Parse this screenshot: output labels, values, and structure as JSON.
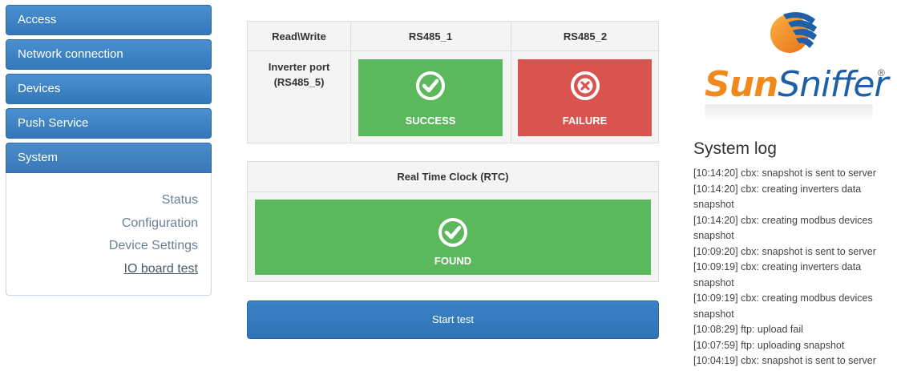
{
  "sidebar": {
    "items": [
      {
        "label": "Access"
      },
      {
        "label": "Network connection"
      },
      {
        "label": "Devices"
      },
      {
        "label": "Push Service"
      },
      {
        "label": "System"
      }
    ],
    "submenu": [
      {
        "label": "Status"
      },
      {
        "label": "Configuration"
      },
      {
        "label": "Device Settings"
      },
      {
        "label": "IO board test"
      }
    ]
  },
  "port_test": {
    "header_rw": "Read\\Write",
    "col1": "RS485_1",
    "col2": "RS485_2",
    "row_label": "Inverter port (RS485_5)",
    "result1": {
      "label": "SUCCESS",
      "icon": "check-circle-icon",
      "color": "#5cb85c"
    },
    "result2": {
      "label": "FAILURE",
      "icon": "x-circle-icon",
      "color": "#d9534f"
    }
  },
  "rtc": {
    "title": "Real Time Clock (RTC)",
    "result": {
      "label": "FOUND",
      "icon": "check-circle-icon",
      "color": "#5cb85c"
    }
  },
  "start_button": "Start test",
  "logo": {
    "part1": "Sun",
    "part2": "Sniffer",
    "reg": "®"
  },
  "system_log": {
    "title": "System log",
    "lines": [
      "[10:14:20] cbx: snapshot is sent to server",
      "[10:14:20] cbx: creating inverters data",
      "snapshot",
      "[10:14:20] cbx: creating modbus devices",
      "snapshot",
      "[10:09:20] cbx: snapshot is sent to server",
      "[10:09:19] cbx: creating inverters data",
      "snapshot",
      "[10:09:19] cbx: creating modbus devices",
      "snapshot",
      "[10:08:29] ftp: upload fail",
      "[10:07:59] ftp: uploading snapshot",
      "[10:04:19] cbx: snapshot is sent to server"
    ]
  }
}
